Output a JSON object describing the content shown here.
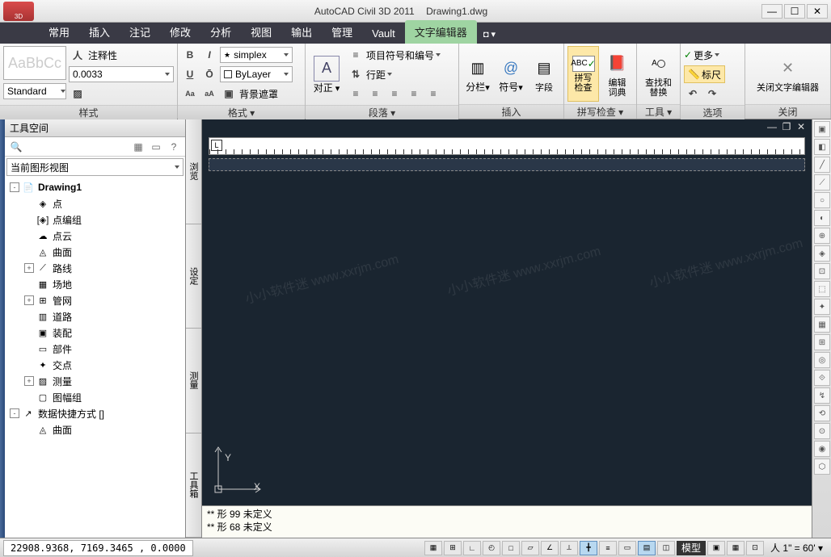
{
  "app": {
    "icon_label": "3D",
    "title": "AutoCAD Civil 3D 2011",
    "document": "Drawing1.dwg"
  },
  "menu": {
    "tabs": [
      "常用",
      "插入",
      "注记",
      "修改",
      "分析",
      "视图",
      "输出",
      "管理",
      "Vault",
      "文字编辑器"
    ],
    "active_index": 9,
    "extra": "◘ ▾"
  },
  "ribbon": {
    "style": {
      "preview": "AaBbCc",
      "annotative_label": "注释性",
      "height_value": "0.0033",
      "current_style": "Standard",
      "panel": "样式"
    },
    "format": {
      "font": "simplex",
      "layer": "ByLayer",
      "mask_label": "背景遮罩",
      "panel": "格式"
    },
    "paragraph": {
      "justify_label": "对正",
      "bullets_label": "项目符号和编号",
      "linespacing_label": "行距",
      "panel": "段落"
    },
    "insert": {
      "columns_label": "分栏",
      "symbol_label": "符号",
      "field_label": "字段",
      "panel": "插入"
    },
    "spellcheck": {
      "check_label": "拼写\n检查",
      "dict_label": "编辑\n词典",
      "panel": "拼写检查"
    },
    "tools": {
      "find_label": "查找和\n替换",
      "panel": "工具"
    },
    "options": {
      "more_label": "更多",
      "ruler_label": "标尺",
      "panel": "选项"
    },
    "close": {
      "close_label": "关闭文字编辑器",
      "panel": "关闭"
    }
  },
  "toolspace": {
    "title": "工具空间",
    "view_combo": "当前图形视图",
    "tree": [
      {
        "level": 0,
        "toggle": "-",
        "icon": "📄",
        "label": "Drawing1",
        "bold": true
      },
      {
        "level": 1,
        "toggle": "",
        "icon": "◈",
        "label": "点"
      },
      {
        "level": 1,
        "toggle": "",
        "icon": "[◈]",
        "label": "点编组"
      },
      {
        "level": 1,
        "toggle": "",
        "icon": "☁",
        "label": "点云"
      },
      {
        "level": 1,
        "toggle": "",
        "icon": "◬",
        "label": "曲面"
      },
      {
        "level": 1,
        "toggle": "+",
        "icon": "⟋",
        "label": "路线"
      },
      {
        "level": 1,
        "toggle": "",
        "icon": "▦",
        "label": "场地"
      },
      {
        "level": 1,
        "toggle": "+",
        "icon": "⊞",
        "label": "管网"
      },
      {
        "level": 1,
        "toggle": "",
        "icon": "▥",
        "label": "道路"
      },
      {
        "level": 1,
        "toggle": "",
        "icon": "▣",
        "label": "装配"
      },
      {
        "level": 1,
        "toggle": "",
        "icon": "▭",
        "label": "部件"
      },
      {
        "level": 1,
        "toggle": "",
        "icon": "✦",
        "label": "交点"
      },
      {
        "level": 1,
        "toggle": "+",
        "icon": "▨",
        "label": "测量"
      },
      {
        "level": 1,
        "toggle": "",
        "icon": "▢",
        "label": "图幅组"
      },
      {
        "level": 0,
        "toggle": "-",
        "icon": "↗",
        "label": "数据快捷方式 []"
      },
      {
        "level": 1,
        "toggle": "",
        "icon": "◬",
        "label": "曲面"
      }
    ],
    "vtabs": [
      "浏览",
      "设定",
      "测量",
      "工具箱"
    ]
  },
  "canvas": {
    "ucs_x": "X",
    "ucs_y": "Y",
    "ruler_mark": "L"
  },
  "cmdline": {
    "line1": "** 形  99  未定义",
    "line2": "** 形  68  未定义"
  },
  "statusbar": {
    "coords": "22908.9368,  7169.3465 , 0.0000",
    "model_label": "模型",
    "scale_label": "1\" = 60'"
  },
  "watermarks": [
    "小小软件迷  www.xxrjm.com",
    "小小软件迷  www.xxrjm.com",
    "小小软件迷  www.xxrjm.com"
  ]
}
